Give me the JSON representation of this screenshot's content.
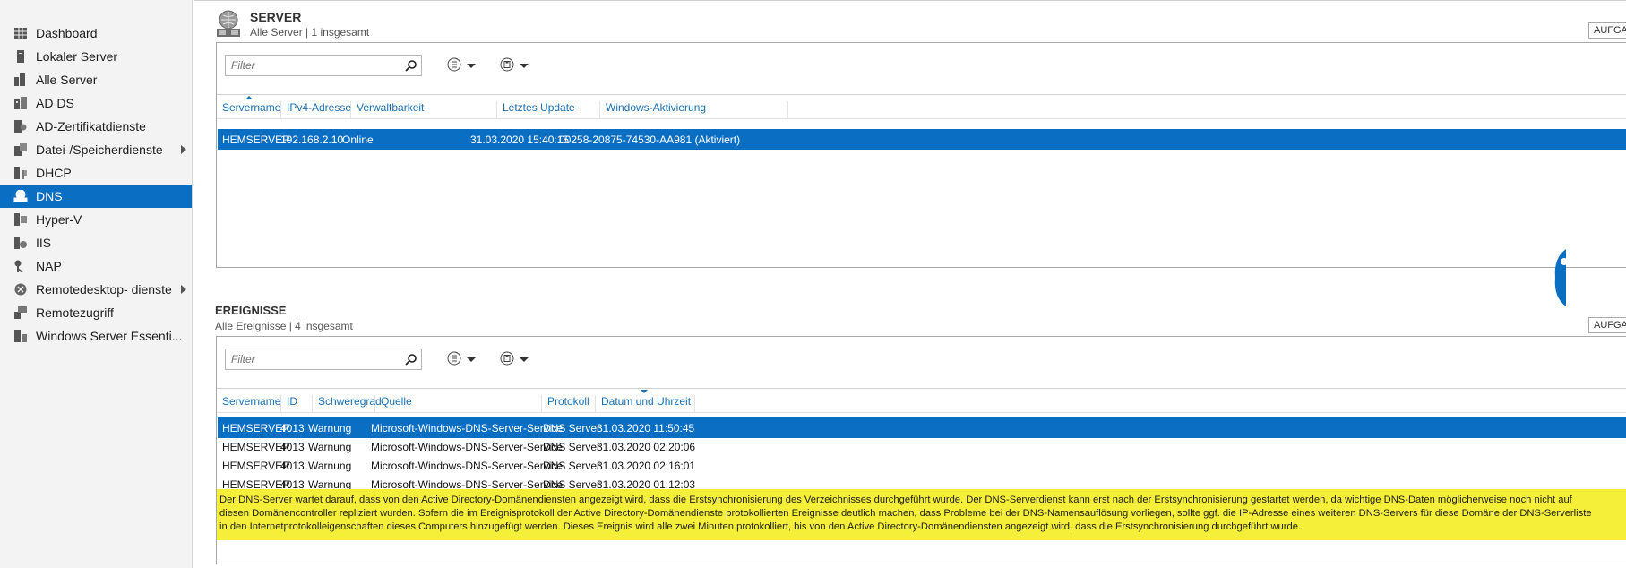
{
  "sidebar": {
    "items": [
      {
        "label": "Dashboard",
        "icon": "dashboard-icon",
        "active": false,
        "has_arrow": false
      },
      {
        "label": "Lokaler Server",
        "icon": "local-server-icon",
        "active": false,
        "has_arrow": false
      },
      {
        "label": "Alle Server",
        "icon": "all-servers-icon",
        "active": false,
        "has_arrow": false
      },
      {
        "label": "AD DS",
        "icon": "ad-ds-icon",
        "active": false,
        "has_arrow": false
      },
      {
        "label": "AD-Zertifikatdienste",
        "icon": "ad-cs-icon",
        "active": false,
        "has_arrow": false
      },
      {
        "label": "Datei-/Speicherdienste",
        "icon": "file-storage-icon",
        "active": false,
        "has_arrow": true
      },
      {
        "label": "DHCP",
        "icon": "dhcp-icon",
        "active": false,
        "has_arrow": false
      },
      {
        "label": "DNS",
        "icon": "dns-icon",
        "active": true,
        "has_arrow": false
      },
      {
        "label": "Hyper-V",
        "icon": "hyper-v-icon",
        "active": false,
        "has_arrow": false
      },
      {
        "label": "IIS",
        "icon": "iis-icon",
        "active": false,
        "has_arrow": false
      },
      {
        "label": "NAP",
        "icon": "nap-icon",
        "active": false,
        "has_arrow": false
      },
      {
        "label": "Remotedesktop- dienste",
        "icon": "remote-desktop-icon",
        "active": false,
        "has_arrow": true
      },
      {
        "label": "Remotezugriff",
        "icon": "remote-access-icon",
        "active": false,
        "has_arrow": false
      },
      {
        "label": "Windows Server Essenti...",
        "icon": "windows-server-essentials-icon",
        "active": false,
        "has_arrow": false
      }
    ]
  },
  "servers": {
    "title": "SERVER",
    "subtitle": "Alle Server | 1 insgesamt",
    "tasks_label": "AUFGABEN",
    "filter_placeholder": "Filter",
    "columns": [
      "Servername",
      "IPv4-Adresse",
      "Verwaltbarkeit",
      "Letztes Update",
      "Windows-Aktivierung"
    ],
    "rows": [
      {
        "name": "HEMSERVER",
        "ip": "192.168.2.10",
        "manageability": "Online",
        "last_update": "31.03.2020 15:40:15",
        "activation": "00258-20875-74530-AA981 (Aktiviert)",
        "selected": true
      }
    ]
  },
  "events": {
    "title": "EREIGNISSE",
    "subtitle": "Alle Ereignisse | 4 insgesamt",
    "tasks_label": "AUFGABEN",
    "filter_placeholder": "Filter",
    "columns": [
      "Servername",
      "ID",
      "Schweregrad",
      "Quelle",
      "Protokoll",
      "Datum und Uhrzeit"
    ],
    "rows": [
      {
        "server": "HEMSERVER",
        "id": "4013",
        "severity": "Warnung",
        "source": "Microsoft-Windows-DNS-Server-Service",
        "log": "DNS Server",
        "datetime": "31.03.2020 11:50:45",
        "selected": true
      },
      {
        "server": "HEMSERVER",
        "id": "4013",
        "severity": "Warnung",
        "source": "Microsoft-Windows-DNS-Server-Service",
        "log": "DNS Server",
        "datetime": "31.03.2020 02:20:06",
        "selected": false
      },
      {
        "server": "HEMSERVER",
        "id": "4013",
        "severity": "Warnung",
        "source": "Microsoft-Windows-DNS-Server-Service",
        "log": "DNS Server",
        "datetime": "31.03.2020 02:16:01",
        "selected": false
      },
      {
        "server": "HEMSERVER",
        "id": "4013",
        "severity": "Warnung",
        "source": "Microsoft-Windows-DNS-Server-Service",
        "log": "DNS Server",
        "datetime": "31.03.2020 01:12:03",
        "selected": false
      }
    ],
    "detail_lines": [
      "Der DNS-Server wartet darauf, dass von den Active Directory-Domänendiensten angezeigt wird, dass die Erstsynchronisierung des Verzeichnisses durchgeführt wurde. Der DNS-Serverdienst kann erst nach der Erstsynchronisierung gestartet werden, da wichtige DNS-Daten möglicherweise noch nicht auf",
      "diesen Domänencontroller repliziert wurden. Sofern die im Ereignisprotokoll der Active Directory-Domänendienste protokollierten Ereignisse deutlich machen, dass Probleme bei der DNS-Namensauflösung vorliegen, sollte ggf. die IP-Adresse eines weiteren DNS-Servers für diese Domäne der DNS-Serverliste",
      "in den Internetprotokolleigenschaften dieses Computers hinzugefügt werden. Dieses Ereignis wird alle zwei Minuten protokolliert, bis von den Active Directory-Domänendiensten angezeigt wird, dass die Erstsynchronisierung durchgeführt wurde."
    ]
  },
  "colors": {
    "accent": "#0a6fc2",
    "highlight": "#f5ef3a",
    "link": "#1a6fb0"
  }
}
